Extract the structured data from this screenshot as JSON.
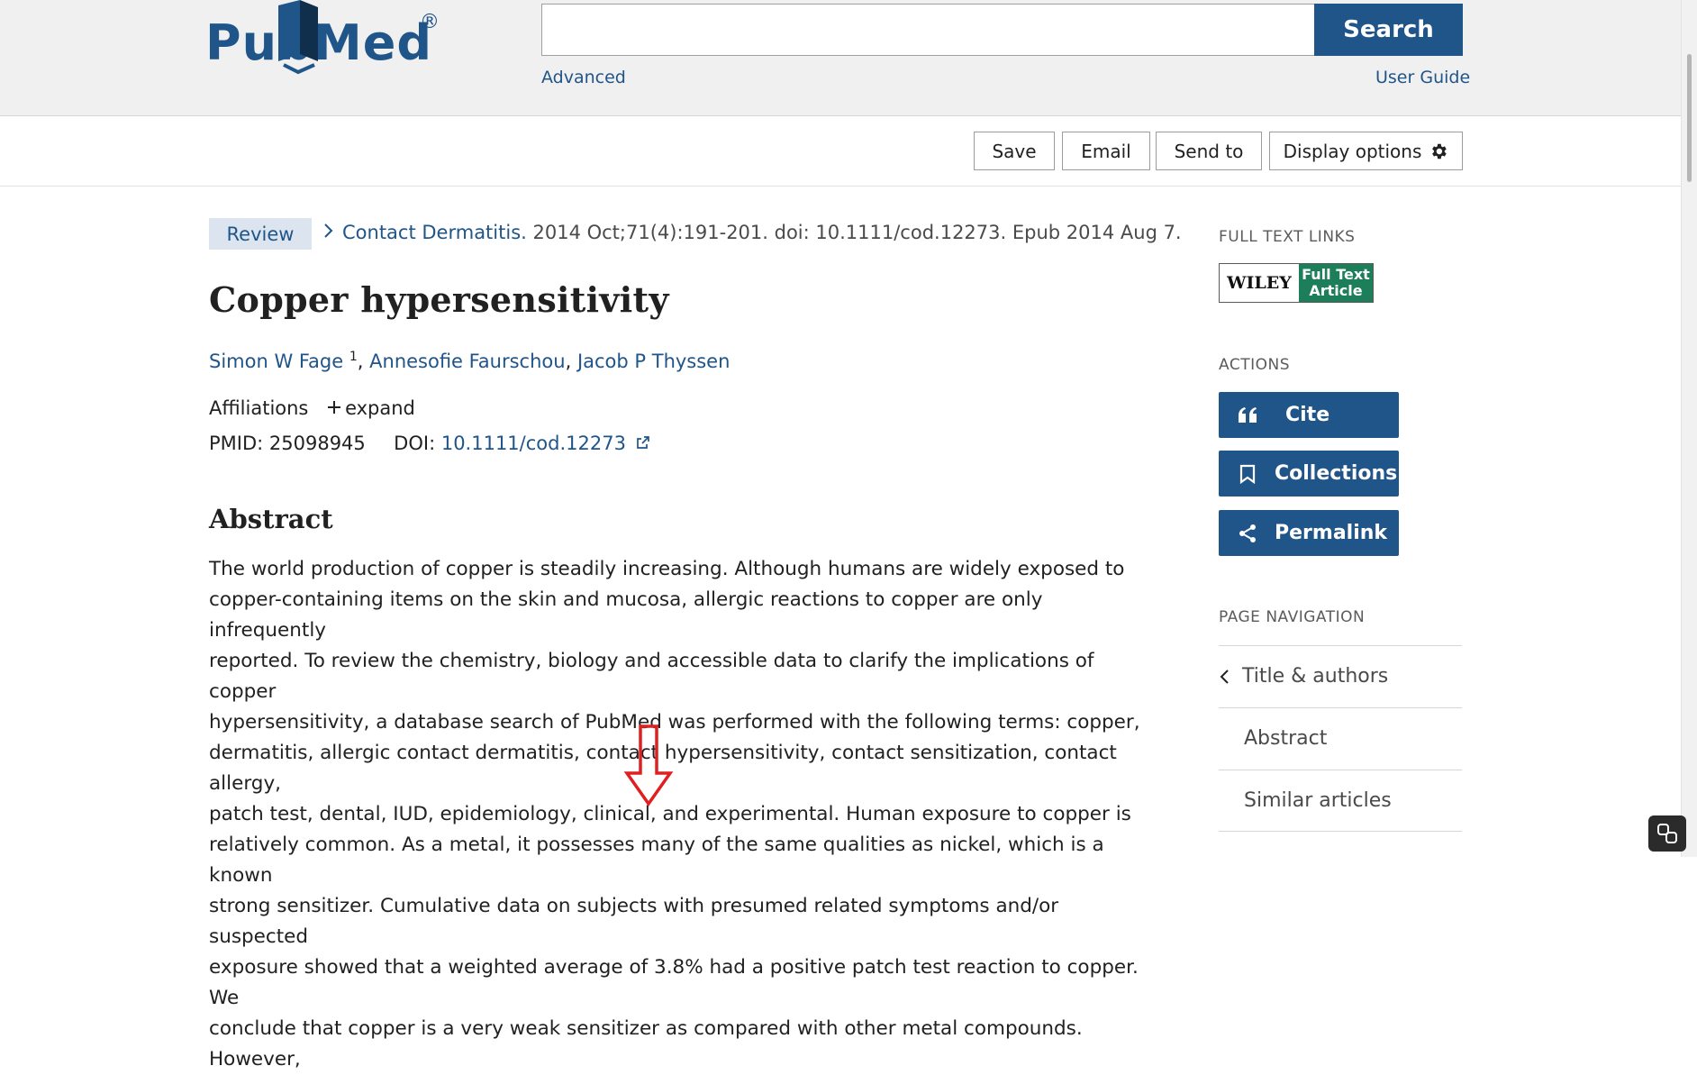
{
  "header": {
    "logo_text_left": "Pub",
    "logo_text_right": "Med",
    "logo_registered": "®",
    "search_value": "",
    "search_button": "Search",
    "advanced": "Advanced",
    "user_guide": "User Guide"
  },
  "toolbar": {
    "save": "Save",
    "email": "Email",
    "send_to": "Send to",
    "display_options": "Display options"
  },
  "article": {
    "badge": "Review",
    "journal": "Contact Dermatitis.",
    "citation_rest": " 2014 Oct;71(4):191-201. doi: 10.1111/cod.12273. Epub 2014 Aug 7.",
    "title": "Copper hypersensitivity",
    "author1": "Simon W Fage",
    "author1_sup": "1",
    "author_sep": ", ",
    "author2": "Annesofie Faurschou",
    "author_sep2": ", ",
    "author3": "Jacob P Thyssen",
    "affiliations": "Affiliations",
    "expand": "expand",
    "pmid_label": "PMID: 25098945",
    "doi_label": "DOI: ",
    "doi_value": "10.1111/cod.12273",
    "abstract_heading": "Abstract",
    "abstract_lines": [
      "The world production of copper is steadily increasing. Although humans are widely exposed to",
      "copper-containing items on the skin and mucosa, allergic reactions to copper are only infrequently",
      "reported. To review the chemistry, biology and accessible data to clarify the implications of copper",
      "hypersensitivity, a database search of PubMed was performed with the following terms: copper,",
      "dermatitis, allergic contact dermatitis, contact hypersensitivity, contact sensitization, contact allergy,",
      "patch test, dental, IUD, epidemiology, clinical, and experimental. Human exposure to copper is",
      "relatively common. As a metal, it possesses many of the same qualities as nickel, which is a known",
      "strong sensitizer. Cumulative data on subjects with presumed related symptoms and/or suspected",
      "exposure showed that a weighted average of 3.8% had a positive patch test reaction to copper. We",
      "conclude that copper is a very weak sensitizer as compared with other metal compounds. However,"
    ]
  },
  "sidebar": {
    "full_text_links": "FULL TEXT LINKS",
    "wiley_left": "WILEY",
    "wiley_right_1": "Full Text",
    "wiley_right_2": "Article",
    "actions": "ACTIONS",
    "cite": "Cite",
    "collections": "Collections",
    "permalink": "Permalink",
    "page_navigation": "PAGE NAVIGATION",
    "nav_items": [
      "Title & authors",
      "Abstract",
      "Similar articles"
    ]
  },
  "colors": {
    "brand": "#20558a",
    "annotation_arrow": "#e02020",
    "wiley_green": "#1d7f5a"
  }
}
